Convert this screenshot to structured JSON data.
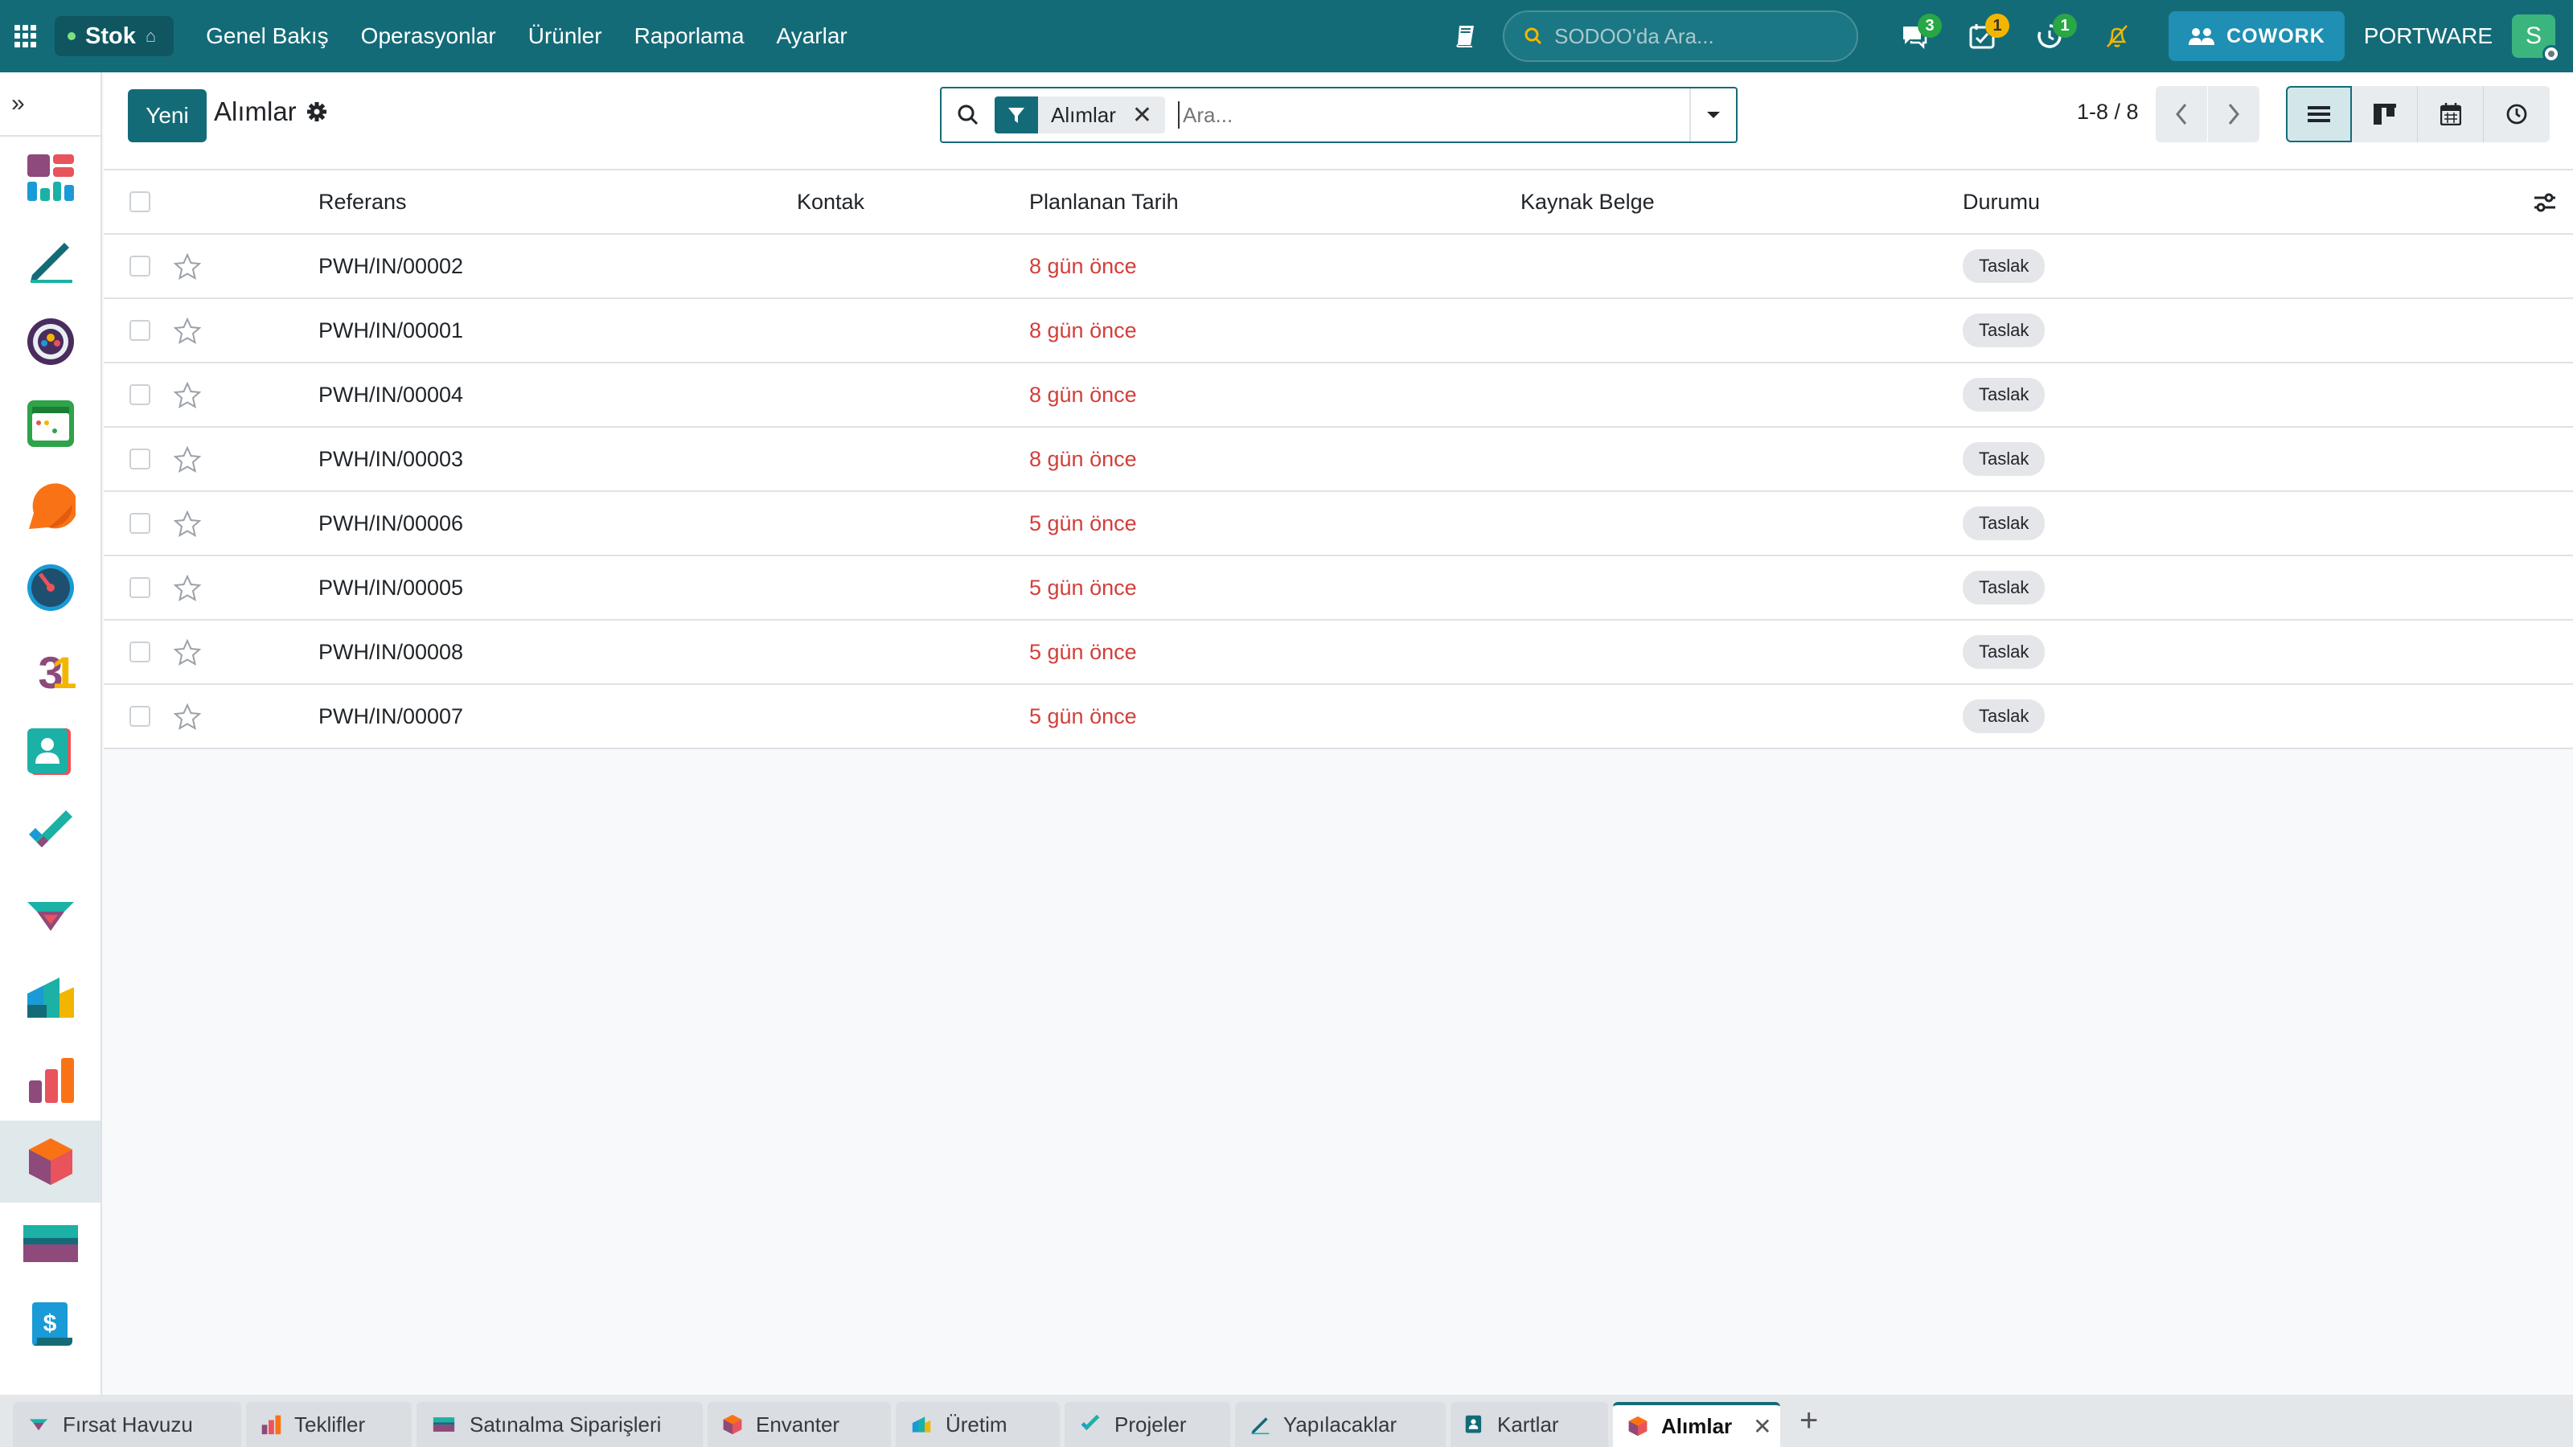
{
  "nav": {
    "app_name": "Stok",
    "menu": [
      "Genel Bakış",
      "Operasyonlar",
      "Ürünler",
      "Raporlama",
      "Ayarlar"
    ],
    "search_placeholder": "SODOO'da Ara...",
    "badges": {
      "messages": "3",
      "activities": "1",
      "timer": "1"
    },
    "cowork_label": "COWORK",
    "company": "PORTWARE",
    "avatar_initial": "S"
  },
  "sidebar": {
    "expand_glyph": "»",
    "apps": [
      "dashboard-icon",
      "pen-icon",
      "team-icon",
      "planning-icon",
      "chat-bubble-icon",
      "gauge-icon",
      "calendar-icon",
      "contacts-icon",
      "checkmark-icon",
      "handshake-icon",
      "manufacturing-icon",
      "chart-icon",
      "inventory-cube-icon",
      "card-icon",
      "invoice-icon"
    ]
  },
  "control": {
    "new_label": "Yeni",
    "title": "Alımlar",
    "facet_label": "Alımlar",
    "facet_close": "✕",
    "search_placeholder": "Ara...",
    "pager": "1-8 / 8"
  },
  "table": {
    "headers": {
      "ref": "Referans",
      "contact": "Kontak",
      "date": "Planlanan Tarih",
      "source": "Kaynak Belge",
      "state": "Durumu"
    },
    "rows": [
      {
        "ref": "PWH/IN/00002",
        "contact": "",
        "date": "8 gün önce",
        "source": "",
        "state": "Taslak"
      },
      {
        "ref": "PWH/IN/00001",
        "contact": "",
        "date": "8 gün önce",
        "source": "",
        "state": "Taslak"
      },
      {
        "ref": "PWH/IN/00004",
        "contact": "",
        "date": "8 gün önce",
        "source": "",
        "state": "Taslak"
      },
      {
        "ref": "PWH/IN/00003",
        "contact": "",
        "date": "8 gün önce",
        "source": "",
        "state": "Taslak"
      },
      {
        "ref": "PWH/IN/00006",
        "contact": "",
        "date": "5 gün önce",
        "source": "",
        "state": "Taslak"
      },
      {
        "ref": "PWH/IN/00005",
        "contact": "",
        "date": "5 gün önce",
        "source": "",
        "state": "Taslak"
      },
      {
        "ref": "PWH/IN/00008",
        "contact": "",
        "date": "5 gün önce",
        "source": "",
        "state": "Taslak"
      },
      {
        "ref": "PWH/IN/00007",
        "contact": "",
        "date": "5 gün önce",
        "source": "",
        "state": "Taslak"
      }
    ]
  },
  "tabs": [
    {
      "label": "Fırsat Havuzu",
      "active": false
    },
    {
      "label": "Teklifler",
      "active": false
    },
    {
      "label": "Satınalma Siparişleri",
      "active": false
    },
    {
      "label": "Envanter",
      "active": false
    },
    {
      "label": "Üretim",
      "active": false
    },
    {
      "label": "Projeler",
      "active": false
    },
    {
      "label": "Yapılacaklar",
      "active": false
    },
    {
      "label": "Kartlar",
      "active": false
    },
    {
      "label": "Alımlar",
      "active": true
    }
  ],
  "tab_close": "✕",
  "tab_add": "+",
  "colors": {
    "brand": "#146b78",
    "overdue": "#d23f3a"
  }
}
